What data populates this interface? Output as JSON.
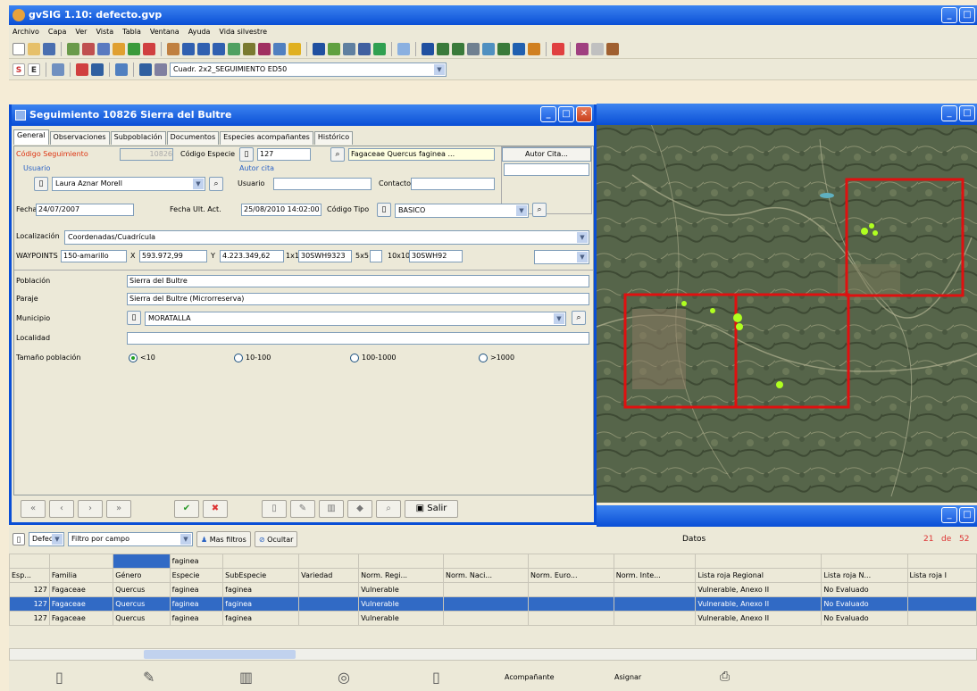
{
  "app": {
    "title": "gvSIG 1.10: defecto.gvp"
  },
  "menu": [
    "Archivo",
    "Capa",
    "Ver",
    "Vista",
    "Tabla",
    "Ventana",
    "Ayuda",
    "Vida silvestre"
  ],
  "toolbar2": {
    "s": "S",
    "e": "E",
    "layer_combo": "Cuadr. 2x2_SEGUIMIENTO ED50"
  },
  "dialog": {
    "title": "Seguimiento 10826 Sierra del Bultre",
    "tabs": [
      "General",
      "Observaciones",
      "Subpoblación",
      "Documentos",
      "Especies acompañantes",
      "Histórico"
    ],
    "codigo_seguimiento_label": "Código Seguimiento",
    "codigo_seguimiento": "10826",
    "codigo_especie_label": "Código Especie",
    "codigo_especie": "127",
    "especie": "Fagaceae Quercus faginea ...",
    "autor_cita_btn": "Autor Cita...",
    "usuario_label": "Usuario",
    "usuario": "Laura Aznar Morell",
    "autor_cita_label": "Autor cita",
    "usuario2_label": "Usuario",
    "contacto_label": "Contacto",
    "fecha_label": "Fecha",
    "fecha": "24/07/2007",
    "fecha_ult_label": "Fecha Ult. Act.",
    "fecha_ult": "25/08/2010 14:02:00",
    "codigo_tipo_label": "Código Tipo",
    "codigo_tipo": "BASICO",
    "localizacion_label": "Localización",
    "localizacion": "Coordenadas/Cuadrícula",
    "waypoints_label": "WAYPOINTS",
    "waypoints": "150-amarillo",
    "x_label": "X",
    "x": "593.972,99",
    "y_label": "Y",
    "y": "4.223.349,62",
    "q1_label": "1x1",
    "q1": "30SWH9323",
    "q5_label": "5x5",
    "q10_label": "10x10",
    "q10": "30SWH92",
    "poblacion_label": "Población",
    "poblacion": "Sierra del Bultre",
    "paraje_label": "Paraje",
    "paraje": "Sierra del Bultre (Microrreserva)",
    "municipio_label": "Municipio",
    "municipio": "MORATALLA",
    "localidad_label": "Localidad",
    "tamano_label": "Tamaño población",
    "tamano_opts": [
      "<10",
      "10-100",
      "100-1000",
      ">1000"
    ],
    "salir": "Salir"
  },
  "table": {
    "filter_combo": "Defecto",
    "filter_mode": "Filtro por campo",
    "mas_filtros": "Mas filtros",
    "ocultar": "Ocultar",
    "datos": "Datos",
    "count": "21",
    "de": "de",
    "total": "52",
    "filter_value": "faginea",
    "headers": [
      "Esp...",
      "Familia",
      "Género",
      "Especie",
      "SubEspecie",
      "Variedad",
      "Norm. Regi...",
      "Norm. Naci...",
      "Norm. Euro...",
      "Norm. Inte...",
      "Lista roja Regional",
      "Lista roja N...",
      "Lista roja I"
    ],
    "rows": [
      [
        "127",
        "Fagaceae",
        "Quercus",
        "faginea",
        "faginea",
        "",
        "Vulnerable",
        "",
        "",
        "",
        "Vulnerable, Anexo II",
        "No Evaluado",
        ""
      ],
      [
        "127",
        "Fagaceae",
        "Quercus",
        "faginea",
        "faginea",
        "",
        "Vulnerable",
        "",
        "",
        "",
        "Vulnerable, Anexo II",
        "No Evaluado",
        ""
      ],
      [
        "127",
        "Fagaceae",
        "Quercus",
        "faginea",
        "faginea",
        "",
        "Vulnerable",
        "",
        "",
        "",
        "Vulnerable, Anexo II",
        "No Evaluado",
        ""
      ]
    ]
  },
  "actions": {
    "acompanante": "Acompañante",
    "asignar": "Asignar"
  }
}
